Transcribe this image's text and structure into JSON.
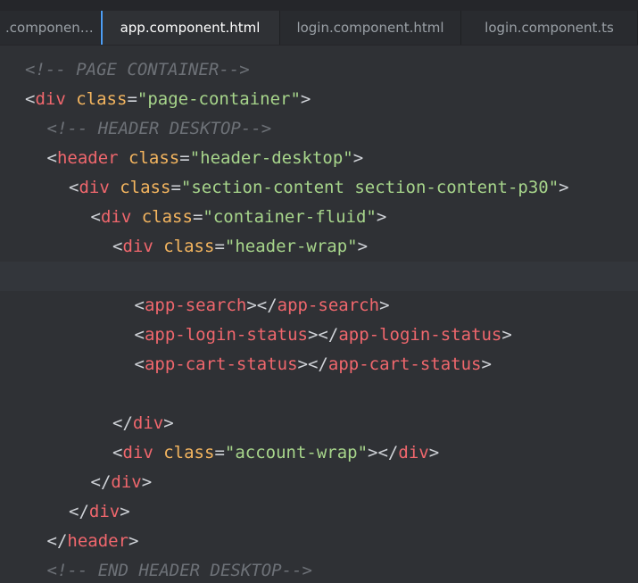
{
  "tabs": [
    {
      "label": ".component...",
      "active": false
    },
    {
      "label": "app.component.html",
      "active": true
    },
    {
      "label": "login.component.html",
      "active": false
    },
    {
      "label": "login.component.ts",
      "active": false
    }
  ],
  "code_lines": [
    {
      "indent": 1,
      "kind": "comment",
      "text": "<!-- PAGE CONTAINER-->"
    },
    {
      "indent": 1,
      "kind": "open_attr",
      "tag": "div",
      "attr": "class",
      "value": "\"page-container\""
    },
    {
      "indent": 2,
      "kind": "comment",
      "text": "<!-- HEADER DESKTOP-->"
    },
    {
      "indent": 2,
      "kind": "open_attr",
      "tag": "header",
      "attr": "class",
      "value": "\"header-desktop\""
    },
    {
      "indent": 3,
      "kind": "open_attr",
      "tag": "div",
      "attr": "class",
      "value": "\"section-content section-content-p30\""
    },
    {
      "indent": 4,
      "kind": "open_attr",
      "tag": "div",
      "attr": "class",
      "value": "\"container-fluid\""
    },
    {
      "indent": 5,
      "kind": "open_attr",
      "tag": "div",
      "attr": "class",
      "value": "\"header-wrap\""
    },
    {
      "indent": 0,
      "kind": "blank",
      "current": true
    },
    {
      "indent": 6,
      "kind": "pair",
      "tag": "app-search"
    },
    {
      "indent": 6,
      "kind": "pair",
      "tag": "app-login-status"
    },
    {
      "indent": 6,
      "kind": "pair",
      "tag": "app-cart-status"
    },
    {
      "indent": 0,
      "kind": "blank"
    },
    {
      "indent": 5,
      "kind": "close",
      "tag": "div"
    },
    {
      "indent": 5,
      "kind": "open_attr_close",
      "tag": "div",
      "attr": "class",
      "value": "\"account-wrap\""
    },
    {
      "indent": 4,
      "kind": "close",
      "tag": "div"
    },
    {
      "indent": 3,
      "kind": "close",
      "tag": "div"
    },
    {
      "indent": 2,
      "kind": "close",
      "tag": "header"
    },
    {
      "indent": 2,
      "kind": "comment",
      "text": "<!-- END HEADER DESKTOP-->"
    }
  ]
}
